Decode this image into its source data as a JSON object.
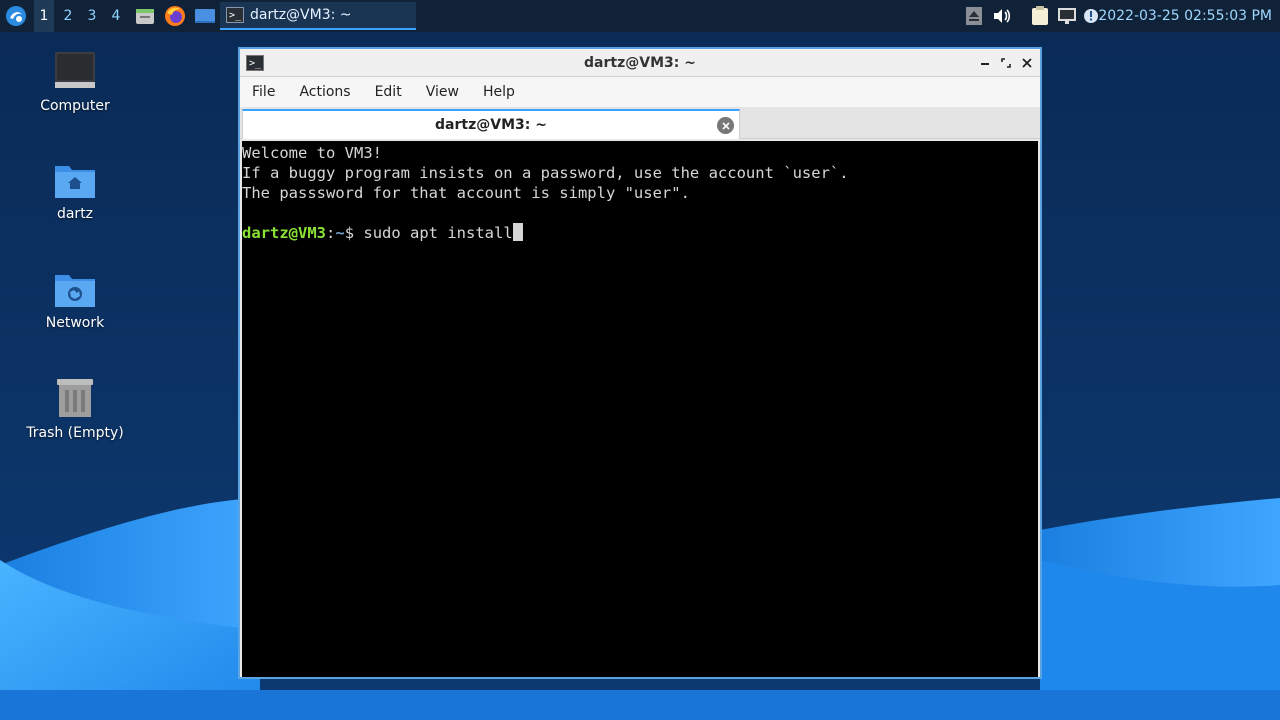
{
  "panel": {
    "workspaces": [
      "1",
      "2",
      "3",
      "4"
    ],
    "active_workspace": "1",
    "taskbar_item": "dartz@VM3: ~",
    "clock": "2022-03-25 02:55:03 PM"
  },
  "desktop": {
    "icons": [
      {
        "label": "Computer",
        "icon": "monitor-icon"
      },
      {
        "label": "dartz",
        "icon": "home-folder-icon"
      },
      {
        "label": "Network",
        "icon": "network-folder-icon"
      },
      {
        "label": "Trash (Empty)",
        "icon": "trash-icon"
      }
    ]
  },
  "window": {
    "title": "dartz@VM3: ~",
    "menu": [
      "File",
      "Actions",
      "Edit",
      "View",
      "Help"
    ],
    "tab_title": "dartz@VM3: ~"
  },
  "terminal": {
    "lines": [
      "Welcome to VM3!",
      "If a buggy program insists on a password, use the account `user`.",
      "The passsword for that account is simply \"user\".",
      ""
    ],
    "prompt_user": "dartz@VM3",
    "prompt_sep": ":",
    "prompt_path": "~",
    "prompt_symbol": "$ ",
    "command": "sudo apt install"
  },
  "colors": {
    "panel_bg": "#0f2238",
    "accent": "#3aa2ff",
    "prompt_user": "#8ae234",
    "prompt_path": "#729fcf"
  }
}
